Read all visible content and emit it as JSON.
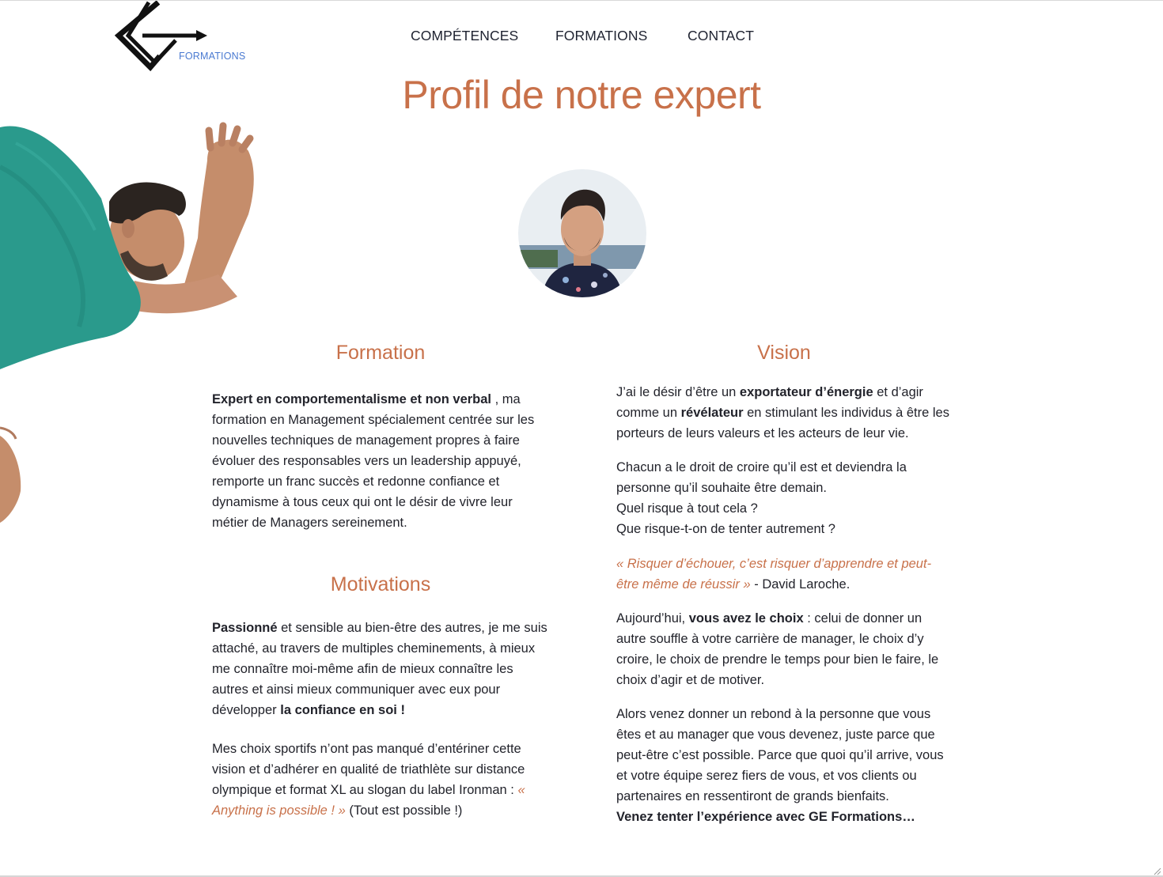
{
  "logo": {
    "text": "FORMATIONS"
  },
  "nav": {
    "items": [
      "COMPÉTENCES",
      "FORMATIONS",
      "CONTACT"
    ]
  },
  "page_title": "Profil de notre expert",
  "formation": {
    "heading": "Formation",
    "b1": "Expert en comportementalisme et non verbal",
    "t1": " , ma formation en Management spécialement centrée sur les nouvelles techniques de management propres à faire évoluer des responsables vers un leadership appuyé, remporte un franc succès et redonne confiance et dynamisme à tous ceux qui ont le désir de vivre leur métier de Managers sereinement."
  },
  "motivations": {
    "heading": "Motivations",
    "b1": "Passionné",
    "t1": " et sensible au bien-être des autres, je me suis attaché, au travers de multiples cheminements, à mieux me connaître moi-même afin de mieux connaître les autres et ainsi mieux communiquer avec eux pour développer ",
    "b2": "la confiance en soi !",
    "p2": "Mes choix sportifs n’ont pas manqué d’entériner cette vision et d’adhérer en qualité de triathlète sur distance olympique et format XL au slogan du label Ironman : ",
    "quote": "« Anything is possible ! »",
    "after_quote": " (Tout est possible !)"
  },
  "vision": {
    "heading": "Vision",
    "p1_a": "J’ai le désir d’être un ",
    "p1_b": "exportateur d’énergie",
    "p1_c": " et d’agir comme un ",
    "p1_d": "révélateur",
    "p1_e": " en stimulant les individus à être les porteurs de leurs valeurs et les acteurs de leur vie.",
    "p2_l1": "Chacun a le droit de croire qu’il est et deviendra la personne qu’il souhaite être demain.",
    "p2_l2": "Quel risque à tout cela ?",
    "p2_l3": "Que risque-t-on de tenter autrement ?",
    "quote": "« Risquer d’échouer, c’est risquer d’apprendre et peut-être même de réussir »",
    "quote_author": " - David Laroche.",
    "p4_a": "Aujourd’hui, ",
    "p4_b": "vous avez le choix",
    "p4_c": " : celui de donner un autre souffle à votre carrière de manager, le choix d’y croire, le choix de prendre le temps pour bien le faire, le choix d’agir et de motiver.",
    "p5": "Alors venez donner un rebond à la personne que vous êtes et au manager que vous devenez, juste parce que peut-être c’est possible. Parce que quoi qu’il arrive, vous et votre équipe serez fiers de vous, et vos clients ou partenaires en ressentiront de grands bienfaits.",
    "p5_b": "Venez tenter l’expérience avec GE Formations…"
  },
  "colors": {
    "accent": "#c8714a",
    "text": "#22232b",
    "nav": "#1e2230",
    "logo_blue": "#4a7ad1",
    "shirt": "#2a9a8c"
  }
}
